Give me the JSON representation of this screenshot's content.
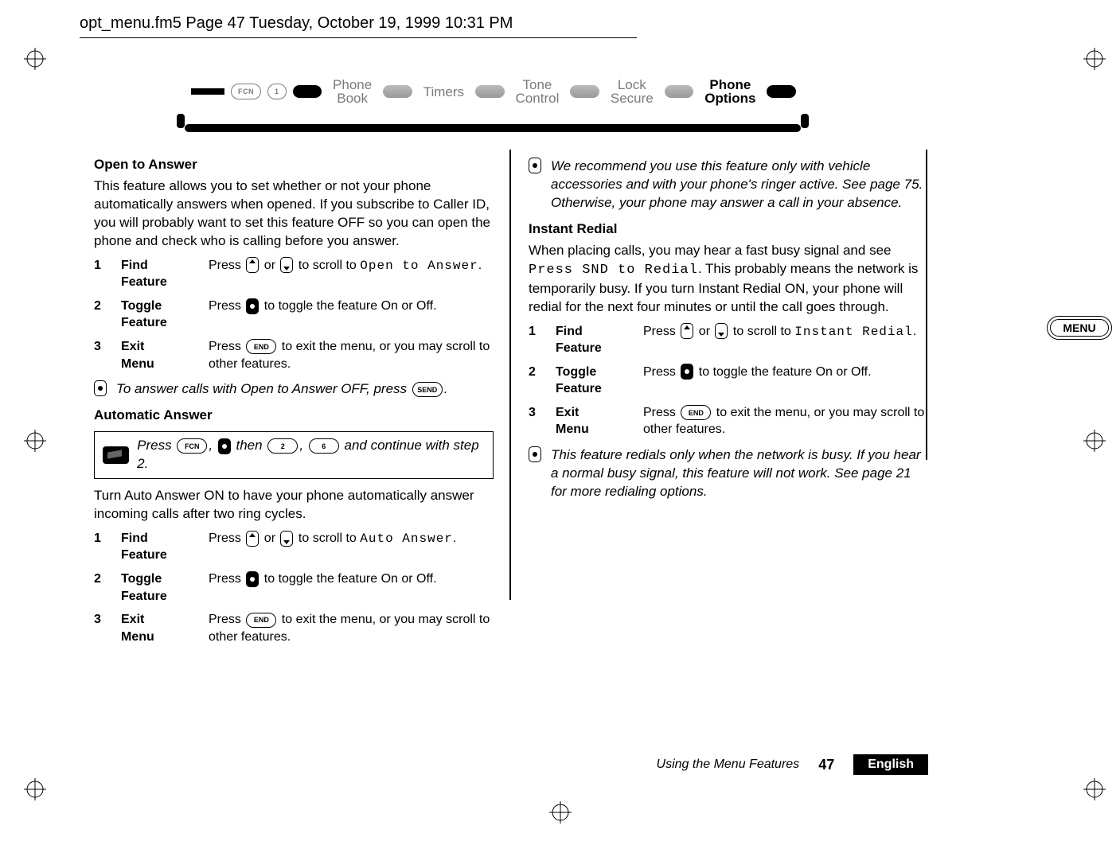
{
  "frame_header": "opt_menu.fm5  Page 47  Tuesday, October 19, 1999  10:31 PM",
  "breadcrumb": {
    "lead_keys": [
      "FCN",
      "1"
    ],
    "items": [
      {
        "l1": "Phone",
        "l2": "Book",
        "active": false
      },
      {
        "l1": "Timers",
        "l2": "",
        "active": false
      },
      {
        "l1": "Tone",
        "l2": "Control",
        "active": false
      },
      {
        "l1": "Lock",
        "l2": "Secure",
        "active": false
      },
      {
        "l1": "Phone",
        "l2": "Options",
        "active": true
      }
    ]
  },
  "left": {
    "open_to_answer": {
      "title": "Open to Answer",
      "intro": "This feature allows you to set whether or not your phone automatically answers when opened. If you subscribe to Caller ID, you will probably want to set this feature OFF so you can open the phone and check who is calling before you answer.",
      "steps": [
        {
          "num": "1",
          "label_l1": "Find",
          "label_l2": "Feature",
          "pre": "Press ",
          "mid": " or ",
          "post": " to scroll to ",
          "mono": "Open to Answer",
          "tail": "."
        },
        {
          "num": "2",
          "label_l1": "Toggle",
          "label_l2": "Feature",
          "pre": "Press ",
          "post": " to toggle the feature On or Off."
        },
        {
          "num": "3",
          "label_l1": "Exit",
          "label_l2": "Menu",
          "pre": "Press ",
          "key": "END",
          "post": " to exit the menu, or you may scroll to other features."
        }
      ],
      "note": {
        "text_pre": "To answer calls with Open to Answer OFF, press ",
        "key": "SEND",
        "text_post": "."
      }
    },
    "auto_answer": {
      "title": "Automatic Answer",
      "shortcut": {
        "pre": "Press ",
        "k1": "FCN",
        "mid1": ", ",
        "mid2": " then ",
        "k2": "2",
        "mid3": ", ",
        "k3": "6",
        "post": " and continue with step 2."
      },
      "intro": "Turn Auto Answer ON to have your phone automatically answer incoming calls after two ring cycles.",
      "steps": [
        {
          "num": "1",
          "label_l1": "Find",
          "label_l2": "Feature",
          "pre": "Press ",
          "mid": " or ",
          "post": " to scroll to ",
          "mono": "Auto Answer",
          "tail": "."
        },
        {
          "num": "2",
          "label_l1": "Toggle",
          "label_l2": "Feature",
          "pre": "Press ",
          "post": " to toggle the feature On or Off."
        },
        {
          "num": "3",
          "label_l1": "Exit",
          "label_l2": "Menu",
          "pre": "Press ",
          "key": "END",
          "post": " to exit the menu, or you may scroll to other features."
        }
      ]
    }
  },
  "right": {
    "top_note": "We recommend you use this feature only with vehicle accessories and with your phone's ringer active. See page 75. Otherwise, your phone may answer a call in your absence.",
    "instant_redial": {
      "title": "Instant Redial",
      "intro_pre": "When placing calls, you may hear a fast busy signal and see ",
      "intro_mono": "Press SND to Redial",
      "intro_post": ". This probably means the network is temporarily busy. If you turn Instant Redial ON, your phone will redial for the next four minutes or until the call goes through.",
      "steps": [
        {
          "num": "1",
          "label_l1": "Find",
          "label_l2": "Feature",
          "pre": "Press ",
          "mid": " or ",
          "post": " to scroll to ",
          "mono": "Instant Redial",
          "tail": "."
        },
        {
          "num": "2",
          "label_l1": "Toggle",
          "label_l2": "Feature",
          "pre": "Press ",
          "post": " to toggle the feature On or Off."
        },
        {
          "num": "3",
          "label_l1": "Exit",
          "label_l2": "Menu",
          "pre": "Press ",
          "key": "END",
          "post": " to exit the menu, or you may scroll to other features."
        }
      ],
      "note": "This feature redials only when the network is busy. If you hear a normal busy signal, this feature will not work. See page 21 for more redialing options."
    }
  },
  "side_tab": "MENU",
  "footer": {
    "title": "Using the Menu Features",
    "page": "47",
    "lang": "English"
  }
}
